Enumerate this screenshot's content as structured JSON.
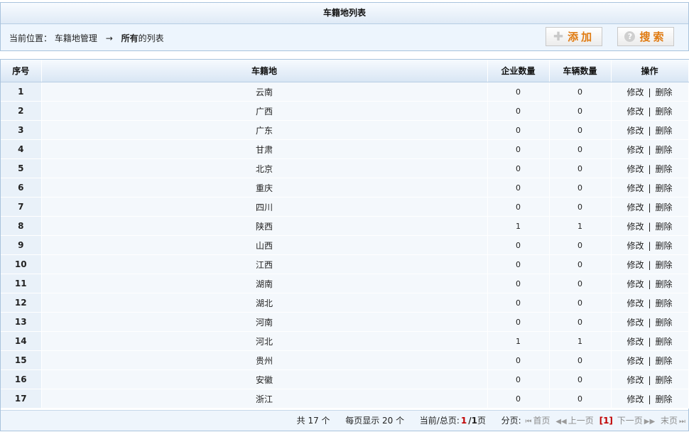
{
  "title": "车籍地列表",
  "breadcrumb": {
    "prefix": "当前位置：",
    "section": "车籍地管理",
    "arrow": "→",
    "current_bold": "所有",
    "current_rest": "的列表"
  },
  "toolbar": {
    "add_label": "添加",
    "search_label": "搜索",
    "add_icon": "plus-icon",
    "search_icon": "question-icon"
  },
  "table": {
    "headers": [
      "序号",
      "车籍地",
      "企业数量",
      "车辆数量",
      "操作"
    ],
    "edit_label": "修改",
    "delete_label": "删除",
    "separator": "|",
    "rows": [
      {
        "no": "1",
        "name": "云南",
        "companies": "0",
        "vehicles": "0"
      },
      {
        "no": "2",
        "name": "广西",
        "companies": "0",
        "vehicles": "0"
      },
      {
        "no": "3",
        "name": "广东",
        "companies": "0",
        "vehicles": "0"
      },
      {
        "no": "4",
        "name": "甘肃",
        "companies": "0",
        "vehicles": "0"
      },
      {
        "no": "5",
        "name": "北京",
        "companies": "0",
        "vehicles": "0"
      },
      {
        "no": "6",
        "name": "重庆",
        "companies": "0",
        "vehicles": "0"
      },
      {
        "no": "7",
        "name": "四川",
        "companies": "0",
        "vehicles": "0"
      },
      {
        "no": "8",
        "name": "陕西",
        "companies": "1",
        "vehicles": "1"
      },
      {
        "no": "9",
        "name": "山西",
        "companies": "0",
        "vehicles": "0"
      },
      {
        "no": "10",
        "name": "江西",
        "companies": "0",
        "vehicles": "0"
      },
      {
        "no": "11",
        "name": "湖南",
        "companies": "0",
        "vehicles": "0"
      },
      {
        "no": "12",
        "name": "湖北",
        "companies": "0",
        "vehicles": "0"
      },
      {
        "no": "13",
        "name": "河南",
        "companies": "0",
        "vehicles": "0"
      },
      {
        "no": "14",
        "name": "河北",
        "companies": "1",
        "vehicles": "1"
      },
      {
        "no": "15",
        "name": "贵州",
        "companies": "0",
        "vehicles": "0"
      },
      {
        "no": "16",
        "name": "安徽",
        "companies": "0",
        "vehicles": "0"
      },
      {
        "no": "17",
        "name": "浙江",
        "companies": "0",
        "vehicles": "0"
      }
    ]
  },
  "pager": {
    "total_text": "共 17 个",
    "per_page_text": "每页显示 20 个",
    "current_label": "当前/总页:",
    "current_page": "1",
    "total_pages": "/1",
    "page_suffix": "页",
    "nav_label": "分页:",
    "first": "首页",
    "prev": "上一页",
    "current_bracket": "[1]",
    "next": "下一页",
    "last": "末页"
  }
}
